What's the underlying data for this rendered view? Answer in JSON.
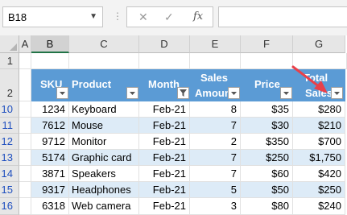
{
  "formula_bar": {
    "name_box": "B18",
    "cancel_icon": "✕",
    "enter_icon": "✓",
    "function_icon": "fx",
    "formula": ""
  },
  "columns": [
    "A",
    "B",
    "C",
    "D",
    "E",
    "F",
    "G"
  ],
  "rows": [
    "1",
    "2",
    "10",
    "11",
    "12",
    "13",
    "14",
    "15",
    "16"
  ],
  "table": {
    "headers": {
      "sku": "SKU",
      "product": "Product",
      "month": "Month",
      "sales_amount_1": "Sales",
      "sales_amount_2": "Amount",
      "price": "Price",
      "total_sales_1": "Total",
      "total_sales_2": "Sales"
    },
    "data": [
      {
        "sku": "1234",
        "product": "Keyboard",
        "month": "Feb-21",
        "amount": "8",
        "price": "$35",
        "total": "$280"
      },
      {
        "sku": "7612",
        "product": "Mouse",
        "month": "Feb-21",
        "amount": "7",
        "price": "$30",
        "total": "$210"
      },
      {
        "sku": "9712",
        "product": "Monitor",
        "month": "Feb-21",
        "amount": "2",
        "price": "$350",
        "total": "$700"
      },
      {
        "sku": "5174",
        "product": "Graphic card",
        "month": "Feb-21",
        "amount": "7",
        "price": "$250",
        "total": "$1,750"
      },
      {
        "sku": "3871",
        "product": "Speakers",
        "month": "Feb-21",
        "amount": "7",
        "price": "$60",
        "total": "$420"
      },
      {
        "sku": "9317",
        "product": "Headphones",
        "month": "Feb-21",
        "amount": "5",
        "price": "$50",
        "total": "$250"
      },
      {
        "sku": "6318",
        "product": "Web camera",
        "month": "Feb-21",
        "amount": "3",
        "price": "$80",
        "total": "$240"
      }
    ]
  },
  "colors": {
    "header_fill": "#5b9bd5",
    "band_fill": "#ddebf7",
    "filtered_row_number": "#1f4fbf",
    "annotation_arrow": "#e8404a"
  }
}
